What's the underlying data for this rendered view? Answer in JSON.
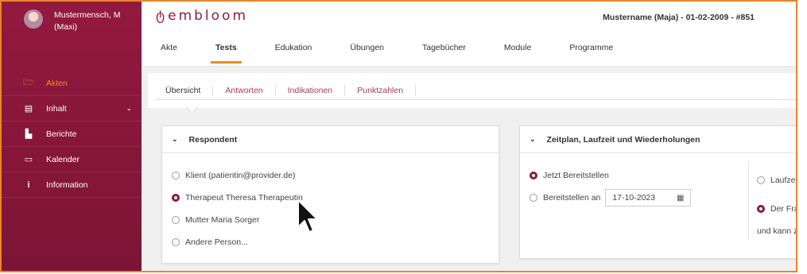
{
  "user": {
    "name": "Mustermensch, M (Maxi)"
  },
  "sidebar": {
    "items": [
      {
        "icon": "folder-icon",
        "glyph": "🗁",
        "label": "Akten",
        "active": true
      },
      {
        "icon": "content-icon",
        "glyph": "▤",
        "label": "Inhalt",
        "has_chevron": true
      },
      {
        "icon": "reports-icon",
        "glyph": "▙",
        "label": "Berichte"
      },
      {
        "icon": "monitor-icon",
        "glyph": "▭",
        "label": "Kalender"
      },
      {
        "icon": "info-icon",
        "glyph": "i",
        "label": "Information"
      }
    ]
  },
  "header": {
    "brand": "embloom",
    "patient": "Mustername (Maja) - 01-02-2009 - #851",
    "tabs": [
      {
        "label": "Akte"
      },
      {
        "label": "Tests",
        "active": true
      },
      {
        "label": "Edukation"
      },
      {
        "label": "Übungen"
      },
      {
        "label": "Tagebücher"
      },
      {
        "label": "Module"
      },
      {
        "label": "Programme"
      }
    ]
  },
  "subnav": {
    "tabs": [
      {
        "label": "Übersicht",
        "active": true
      },
      {
        "label": "Antworten"
      },
      {
        "label": "Indikationen"
      },
      {
        "label": "Punktzahlen"
      }
    ]
  },
  "respondent": {
    "title": "Respondent",
    "options": [
      {
        "label": "Klient (patientin@provider.de)",
        "checked": false
      },
      {
        "label": "Therapeut Theresa Therapeutin",
        "checked": true
      },
      {
        "label": "Mutter Maria Sorger",
        "checked": false
      },
      {
        "label": "Andere Person...",
        "checked": false
      }
    ]
  },
  "schedule": {
    "title": "Zeitplan, Laufzeit und Wiederholungen",
    "opt_now": "Jetzt Bereitstellen",
    "opt_at": "Bereitstellen an",
    "date": "17-10-2023",
    "col2_opt1": "Laufzei",
    "col2_opt2": "Der Fra",
    "col2_text": "und kann z"
  },
  "colors": {
    "primary": "#8a1a3c",
    "accent": "#f08a2a",
    "frame": "#e8862a"
  }
}
